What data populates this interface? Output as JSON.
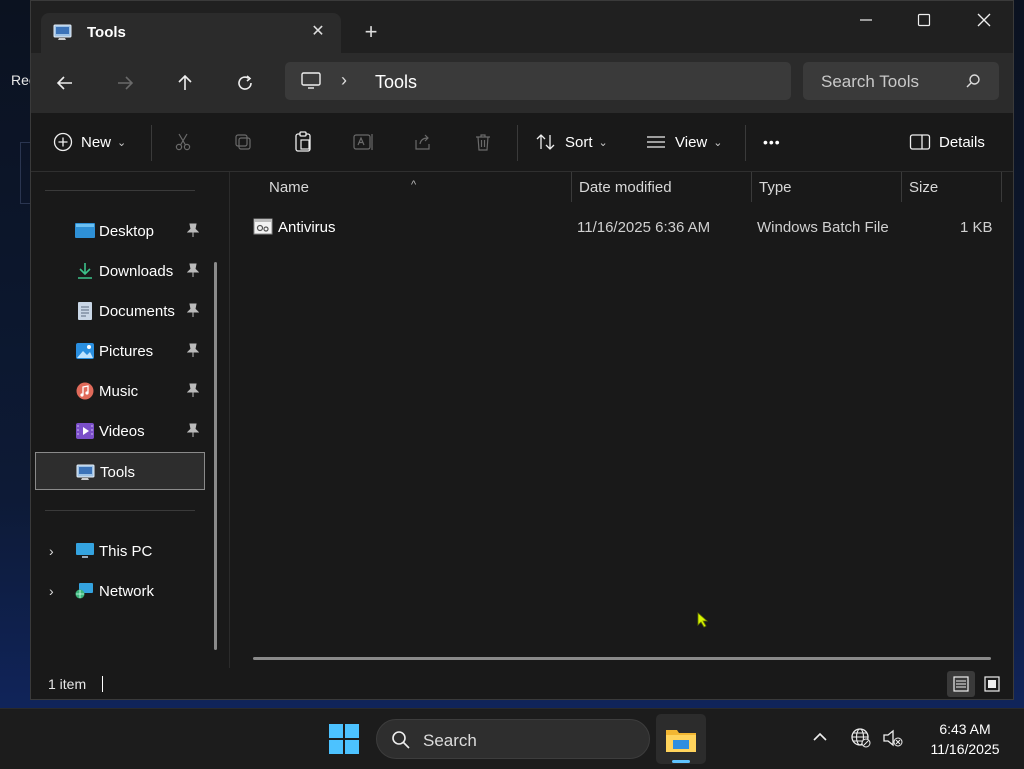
{
  "desktop": {
    "partial_label": "Rec"
  },
  "window": {
    "tab_title": "Tools",
    "tab_close": "✕",
    "new_tab": "+",
    "controls": {
      "minimize": "minimize-icon",
      "maximize": "maximize-icon",
      "close": "close-icon"
    }
  },
  "address": {
    "separator": "›",
    "crumb": "Tools"
  },
  "search": {
    "placeholder": "Search Tools"
  },
  "commands": {
    "new_label": "New",
    "sort_label": "Sort",
    "view_label": "View",
    "more_label": "•••",
    "details_label": "Details",
    "chevron": "⌄"
  },
  "sidebar": {
    "pinned": [
      {
        "label": "Desktop",
        "icon": "desktop-icon",
        "pin": "📌"
      },
      {
        "label": "Downloads",
        "icon": "downloads-icon",
        "pin": "📌"
      },
      {
        "label": "Documents",
        "icon": "documents-icon",
        "pin": "📌"
      },
      {
        "label": "Pictures",
        "icon": "pictures-icon",
        "pin": "📌"
      },
      {
        "label": "Music",
        "icon": "music-icon",
        "pin": "📌"
      },
      {
        "label": "Videos",
        "icon": "videos-icon",
        "pin": "📌"
      },
      {
        "label": "Tools",
        "icon": "folder-icon",
        "selected": true
      }
    ],
    "roots": [
      {
        "label": "This PC",
        "icon": "this-pc-icon",
        "expand": "›"
      },
      {
        "label": "Network",
        "icon": "network-icon",
        "expand": "›"
      }
    ]
  },
  "filelist": {
    "columns": [
      "Name",
      "Date modified",
      "Type",
      "Size"
    ],
    "sort_indicator": "^",
    "rows": [
      {
        "name": "Antivirus",
        "date": "11/16/2025 6:36 AM",
        "type": "Windows Batch File",
        "size": "1 KB",
        "icon": "batch-file-icon"
      }
    ]
  },
  "status": {
    "item_count": "1 item"
  },
  "taskbar": {
    "search_label": "Search",
    "time": "6:43 AM",
    "date": "11/16/2025"
  },
  "colors": {
    "window_bg": "#191919",
    "titlebar_bg": "#202020",
    "accent": "#5ec3ff"
  }
}
